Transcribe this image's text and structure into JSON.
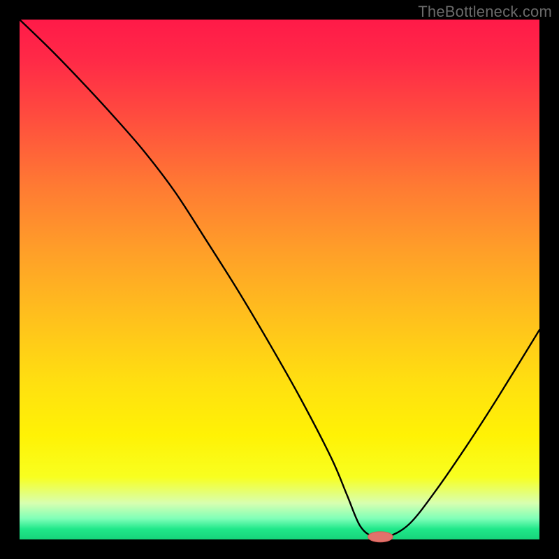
{
  "watermark": {
    "text": "TheBottleneck.com"
  },
  "colors": {
    "stroke": "#000000",
    "marker_fill": "#e2726b",
    "marker_stroke": "#d45a55"
  },
  "chart_data": {
    "type": "line",
    "title": "",
    "xlabel": "",
    "ylabel": "",
    "xlim": [
      0,
      100
    ],
    "ylim": [
      0,
      100
    ],
    "series": [
      {
        "name": "curve",
        "x": [
          0,
          6,
          12,
          18,
          24,
          30,
          36,
          42,
          48,
          54,
          60,
          63,
          65.5,
          68.1,
          70.8,
          75,
          80,
          86,
          92,
          100
        ],
        "y": [
          100,
          94.2,
          88,
          81.5,
          74.6,
          66.7,
          57.4,
          47.9,
          37.8,
          27.2,
          15.6,
          8.5,
          2.6,
          0.5,
          0.5,
          3.0,
          9.3,
          18.0,
          27.3,
          40.3
        ]
      }
    ],
    "marker": {
      "name": "highlight",
      "x": 69.4,
      "y": 0.5,
      "rx_frac": 0.024,
      "ry_frac": 0.01
    },
    "gradient_note": "vertical red→orange→yellow→green heat background"
  }
}
